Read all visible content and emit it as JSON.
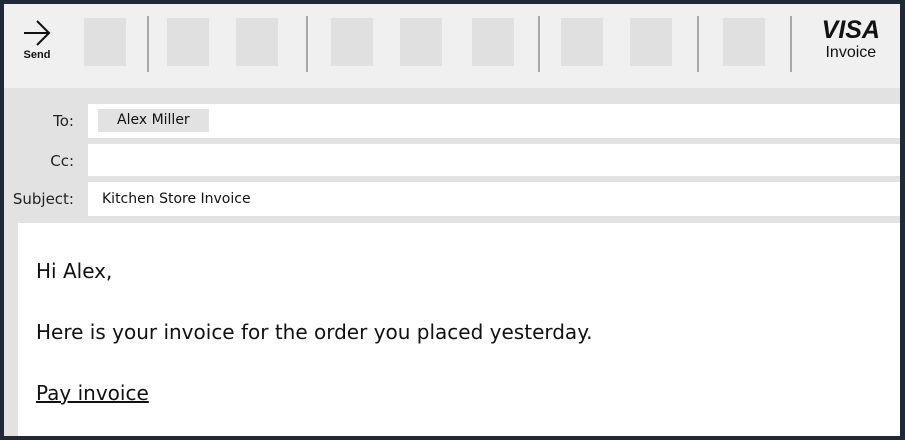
{
  "toolbar": {
    "send_label": "Send",
    "brand": {
      "logo_text": "VISA",
      "sub_label": "Invoice"
    }
  },
  "header": {
    "to_label": "To:",
    "to_recipient": "Alex Miller",
    "cc_label": "Cc:",
    "cc_value": "",
    "subject_label": "Subject:",
    "subject_value": "Kitchen Store Invoice"
  },
  "message": {
    "greeting": "Hi Alex,",
    "line1": "Here is your invoice for the order you placed yesterday.",
    "link_text": "Pay invoice"
  },
  "icons": {
    "send": "arrow-right-icon"
  },
  "colors": {
    "background": "#e2e2e2",
    "toolbar": "#f0f0f0",
    "button_placeholder": "#e0e0e0",
    "text": "#111111"
  }
}
